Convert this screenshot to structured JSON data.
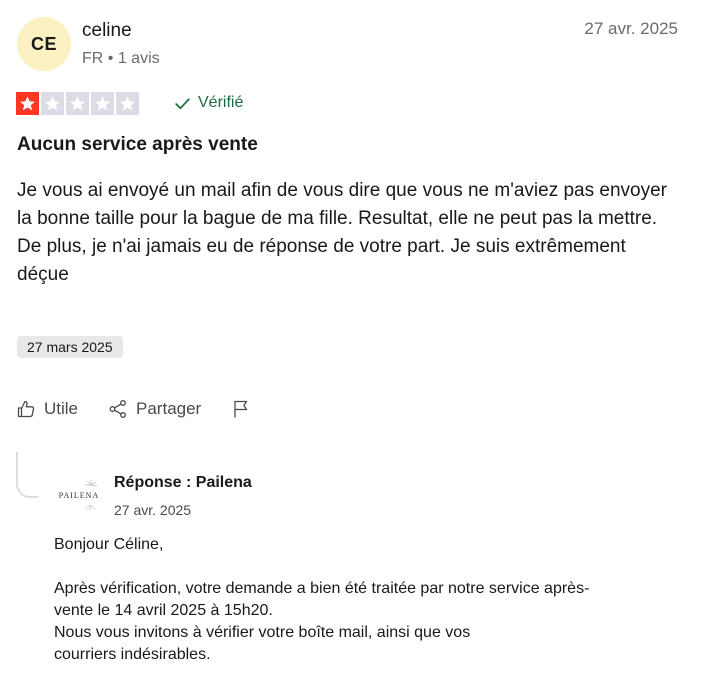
{
  "review": {
    "avatar_initials": "CE",
    "user_name": "celine",
    "user_meta": "FR • 1 avis",
    "date": "27 avr. 2025",
    "rating": 1,
    "max_rating": 5,
    "verified_label": "Vérifié",
    "title": "Aucun service après vente",
    "body_lines": [
      "Je vous ai envoyé un mail afin de vous dire que vous ne m'aviez pas envoyer la bonne taille pour la bague de ma fille. Resultat, elle ne peut pas la mettre.",
      "De plus, je n'ai jamais eu de réponse de votre part. Je suis extrêmement déçue"
    ],
    "experience_date": "27 mars 2025"
  },
  "actions": {
    "useful_label": "Utile",
    "share_label": "Partager"
  },
  "reply": {
    "logo_text": "PAILENA",
    "title": "Réponse : Pailena",
    "date": "27 avr. 2025",
    "greeting": "Bonjour Céline,",
    "para_line1": "Après vérification, votre demande a bien été traitée par notre service après-",
    "para_line2": "vente le 14 avril 2025 à 15h20.",
    "para_line3": "Nous vous invitons à vérifier votre boîte mail, ainsi que vos",
    "para_line4": "courriers indésirables."
  },
  "colors": {
    "star_active": "#ff3722",
    "star_inactive": "#dcdce6",
    "verified": "#1c6b3f",
    "avatar_bg": "#fbf1c3",
    "date_badge_bg": "#e8e8e8"
  },
  "icons": {
    "star": "star-icon",
    "verified": "checkmark-icon",
    "useful": "thumbs-up-icon",
    "share": "share-icon",
    "report": "flag-icon"
  }
}
